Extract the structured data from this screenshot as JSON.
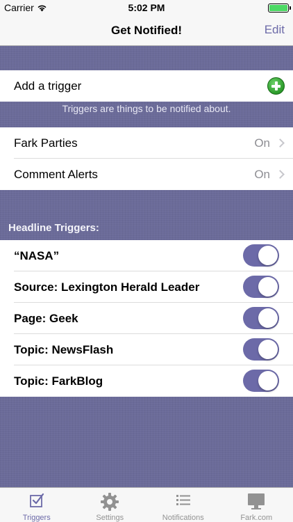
{
  "status_bar": {
    "carrier": "Carrier",
    "time": "5:02 PM"
  },
  "nav": {
    "title": "Get Notified!",
    "edit_label": "Edit"
  },
  "add_trigger": {
    "label": "Add a trigger",
    "icon": "add-circle-icon"
  },
  "triggers_note": "Triggers are things to be notified about.",
  "settings_rows": [
    {
      "label": "Fark Parties",
      "value": "On"
    },
    {
      "label": "Comment Alerts",
      "value": "On"
    }
  ],
  "headline_section": {
    "header": "Headline Triggers:",
    "items": [
      {
        "label": "“NASA”",
        "enabled": true
      },
      {
        "label": "Source: Lexington Herald Leader",
        "enabled": true
      },
      {
        "label": "Page: Geek",
        "enabled": true
      },
      {
        "label": "Topic: NewsFlash",
        "enabled": true
      },
      {
        "label": "Topic: FarkBlog",
        "enabled": true
      }
    ]
  },
  "tab_bar": {
    "tabs": [
      {
        "label": "Triggers",
        "icon": "checkmark-square-icon",
        "active": true
      },
      {
        "label": "Settings",
        "icon": "gear-icon",
        "active": false
      },
      {
        "label": "Notifications",
        "icon": "list-icon",
        "active": false
      },
      {
        "label": "Fark.com",
        "icon": "monitor-icon",
        "active": false
      }
    ]
  },
  "colors": {
    "accent": "#6c6aa8",
    "background": "#6b6b99",
    "toggle_on": "#6c6aa8",
    "add_green": "#2b9a2a"
  }
}
